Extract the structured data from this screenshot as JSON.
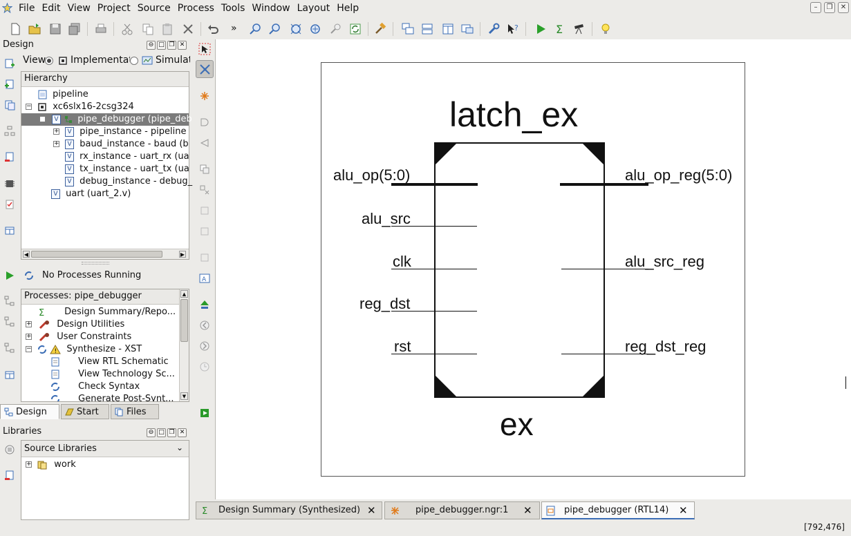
{
  "menubar": {
    "items": [
      "File",
      "Edit",
      "View",
      "Project",
      "Source",
      "Process",
      "Tools",
      "Window",
      "Layout",
      "Help"
    ]
  },
  "design_panel": {
    "title": "Design",
    "view_label": "View:",
    "option_implementation": "Implementati",
    "option_simulation": "Simulat",
    "hierarchy_header": "Hierarchy",
    "tree": [
      "pipeline",
      "xc6slx16-2csg324",
      "pipe_debugger (pipe_deb",
      "pipe_instance - pipeline",
      "baud_instance - baud (b",
      "rx_instance - uart_rx (ua",
      "tx_instance - uart_tx (ua",
      "debug_instance - debug_",
      "uart (uart_2.v)"
    ]
  },
  "process_panel": {
    "status": "No Processes Running",
    "header": "Processes: pipe_debugger",
    "items": [
      "Design Summary/Repo...",
      "Design Utilities",
      "User Constraints",
      "Synthesize - XST",
      "View RTL Schematic",
      "View Technology Sc...",
      "Check Syntax",
      "Generate Post-Synt..."
    ]
  },
  "bottom_tabs": [
    "Design",
    "Start",
    "Files"
  ],
  "libraries_panel": {
    "title": "Libraries",
    "dropdown": "Source Libraries",
    "items": [
      "work"
    ]
  },
  "schematic": {
    "instance_name": "latch_ex",
    "module_name": "ex",
    "inputs": [
      "alu_op(5:0)",
      "alu_src",
      "clk",
      "reg_dst",
      "rst"
    ],
    "outputs": [
      "alu_op_reg(5:0)",
      "alu_src_reg",
      "reg_dst_reg"
    ]
  },
  "editor_tabs": [
    "Design Summary (Synthesized)",
    "pipe_debugger.ngr:1",
    "pipe_debugger (RTL14)"
  ],
  "statusbar": {
    "coords": "[792,476]"
  },
  "colors": {
    "selection": "#7b7b7b",
    "accent": "#3b6db5"
  }
}
